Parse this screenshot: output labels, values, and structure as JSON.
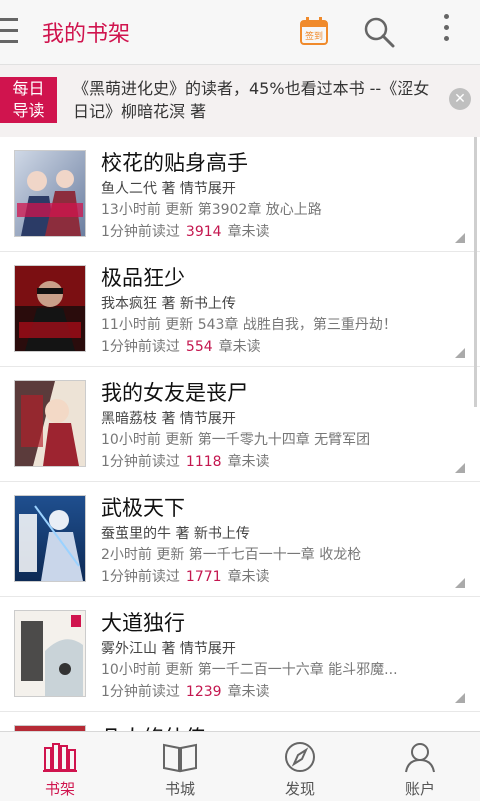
{
  "header": {
    "title": "我的书架",
    "checkin_label": "签到",
    "menu_icon": "hamburger-menu-icon",
    "search_icon": "search-icon",
    "more_icon": "more-vertical-icon"
  },
  "recommend": {
    "badge": "每日导读",
    "text": "《黑萌进化史》的读者，45%也看过本书 --《涩女日记》柳暗花溟 著",
    "close_icon": "close-icon"
  },
  "books": [
    {
      "title": "校花的贴身高手",
      "author_line": "鱼人二代 著 情节展开",
      "update_line": "13小时前 更新 第3902章 放心上路",
      "read_prefix": "1分钟前读过",
      "unread_count": "3914",
      "unread_suffix": "章未读"
    },
    {
      "title": "极品狂少",
      "author_line": "我本疯狂 著 新书上传",
      "update_line": "11小时前 更新 543章 战胜自我，第三重丹劫！",
      "read_prefix": "1分钟前读过",
      "unread_count": "554",
      "unread_suffix": "章未读"
    },
    {
      "title": "我的女友是丧尸",
      "author_line": "黑暗荔枝 著 情节展开",
      "update_line": "10小时前 更新 第一千零九十四章 无臂军团",
      "read_prefix": "1分钟前读过",
      "unread_count": "1118",
      "unread_suffix": "章未读"
    },
    {
      "title": "武极天下",
      "author_line": "蚕茧里的牛 著 新书上传",
      "update_line": "2小时前 更新 第一千七百一十一章 收龙枪",
      "read_prefix": "1分钟前读过",
      "unread_count": "1771",
      "unread_suffix": "章未读"
    },
    {
      "title": "大道独行",
      "author_line": "雾外江山 著 情节展开",
      "update_line": "10小时前 更新 第一千二百一十六章 能斗邪魔...",
      "read_prefix": "1分钟前读过",
      "unread_count": "1239",
      "unread_suffix": "章未读"
    },
    {
      "title": "凡人修仙传",
      "author_line": "",
      "update_line": "",
      "read_prefix": "",
      "unread_count": "",
      "unread_suffix": ""
    }
  ],
  "bottom_nav": [
    {
      "label": "书架",
      "icon": "bookshelf-icon",
      "active": true
    },
    {
      "label": "书城",
      "icon": "open-book-icon",
      "active": false
    },
    {
      "label": "发现",
      "icon": "compass-icon",
      "active": false
    },
    {
      "label": "账户",
      "icon": "user-icon",
      "active": false
    }
  ],
  "colors": {
    "accent": "#d0144e",
    "checkin": "#f08a2b"
  }
}
